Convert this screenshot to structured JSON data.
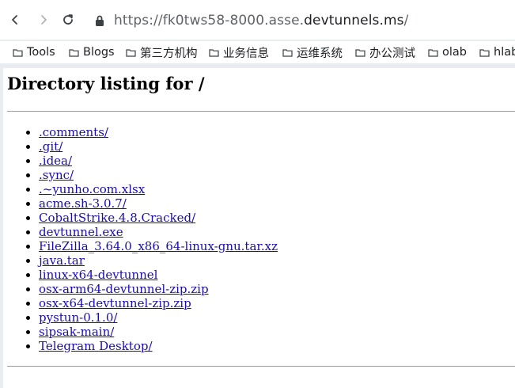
{
  "browser": {
    "url_prefix": "https://fk0tws58-8000.asse.",
    "url_domain": "devtunnels.ms",
    "url_suffix": "/",
    "bookmarks": [
      {
        "label": "Tools"
      },
      {
        "label": "Blogs"
      },
      {
        "label": "第三方机构"
      },
      {
        "label": "业务信息"
      },
      {
        "label": "运维系统"
      },
      {
        "label": "办公测试"
      },
      {
        "label": "olab"
      },
      {
        "label": "hlab"
      }
    ]
  },
  "page": {
    "title": "Directory listing for /",
    "entries": [
      ".comments/",
      ".git/",
      ".idea/",
      ".sync/",
      ".~yunho.com.xlsx",
      "acme.sh-3.0.7/",
      "CobaltStrike.4.8.Cracked/",
      "devtunnel.exe",
      "FileZilla_3.64.0_x86_64-linux-gnu.tar.xz",
      "java.tar",
      "linux-x64-devtunnel",
      "osx-arm64-devtunnel-zip.zip",
      "osx-x64-devtunnel-zip.zip",
      "pystun-0.1.0/",
      "sipsak-main/",
      "Telegram Desktop/"
    ]
  }
}
